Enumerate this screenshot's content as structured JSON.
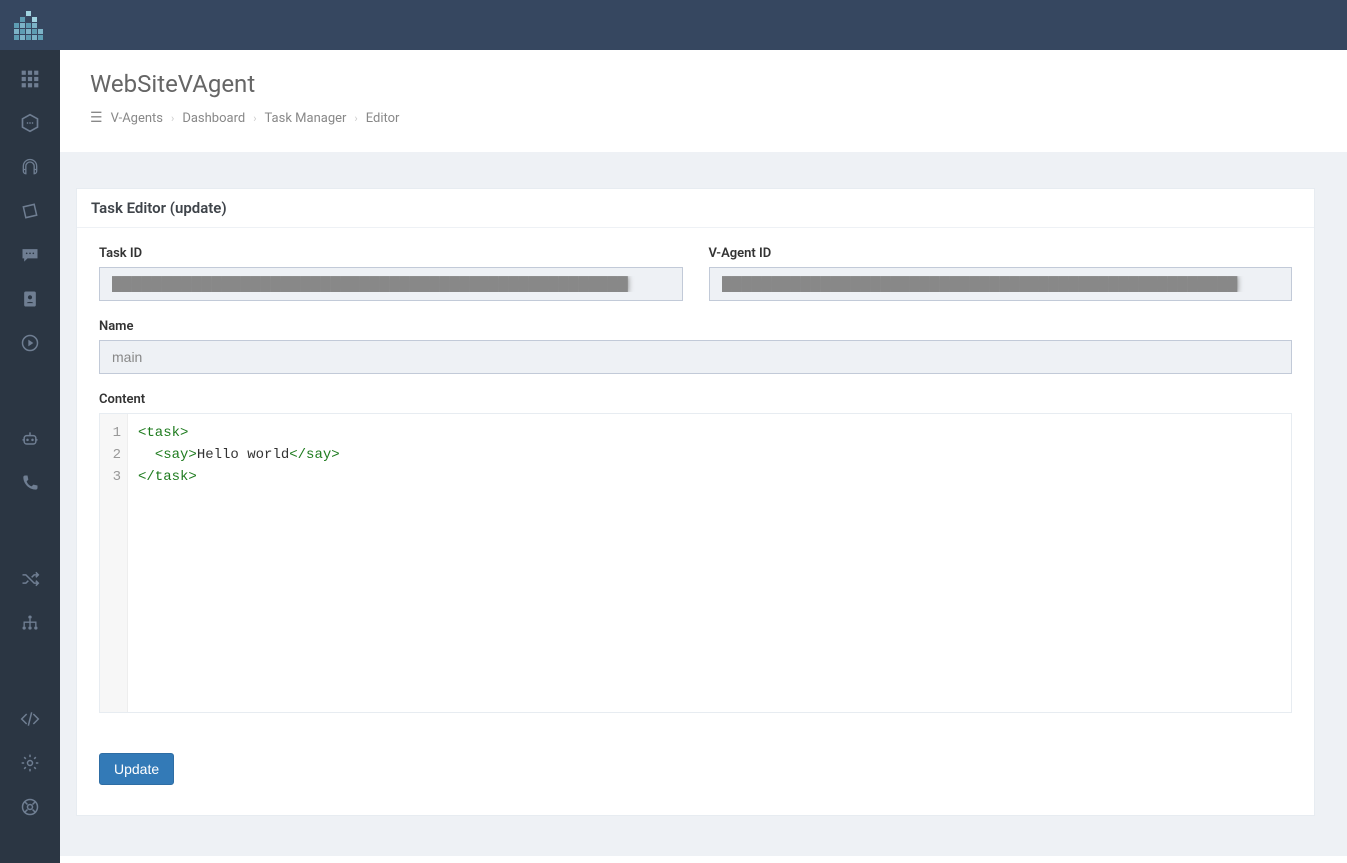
{
  "header": {
    "title": "WebSiteVAgent",
    "breadcrumb": [
      "V-Agents",
      "Dashboard",
      "Task Manager",
      "Editor"
    ]
  },
  "panel": {
    "title": "Task Editor (update)"
  },
  "form": {
    "task_id_label": "Task ID",
    "task_id_value": "████████████████████████████████████████████████████",
    "vagent_id_label": "V-Agent ID",
    "vagent_id_value": "████████████████████████████████████████████████████",
    "name_label": "Name",
    "name_value": "main",
    "content_label": "Content",
    "code_lines": [
      {
        "n": "1",
        "raw": "<task>"
      },
      {
        "n": "2",
        "raw": "  <say>Hello world</say>"
      },
      {
        "n": "3",
        "raw": "</task>"
      }
    ],
    "update_label": "Update"
  },
  "sidebar_icons": [
    "grid-icon",
    "hexagon-icon",
    "headset-icon",
    "ticket-icon",
    "chat-icon",
    "contact-icon",
    "play-icon",
    "robot-icon",
    "phone-icon",
    "shuffle-icon",
    "sitemap-icon",
    "code-icon",
    "gear-icon",
    "support-icon"
  ]
}
